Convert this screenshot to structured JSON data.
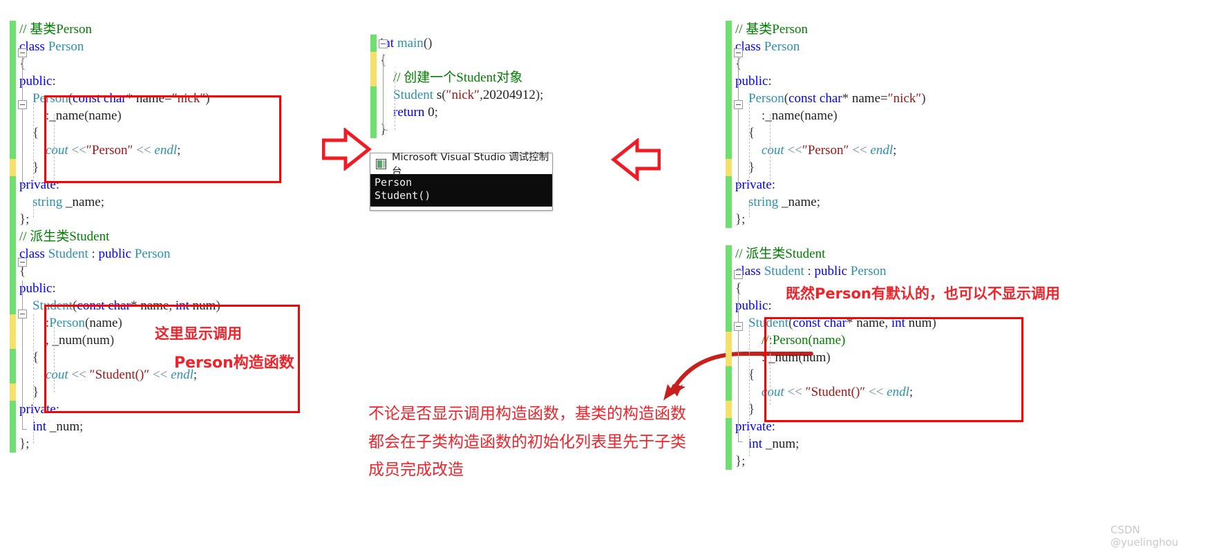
{
  "meta": {
    "watermark": "CSDN @yuelinghou",
    "accent_red": "#ff0000",
    "anno_red": "#f0232a",
    "comment_green": "#008000",
    "string_red": "#a31515",
    "keyword_blue": "#0000ff",
    "type_teal": "#2b91af",
    "gutter_green": "#6fe06f",
    "gutter_yellow": "#f5e06a"
  },
  "left_editor": {
    "name": "explicit-call-version",
    "lines": [
      "// 基类Person",
      "class Person",
      "{",
      "public:",
      "    Person(const char* name=\"nick\")",
      "        :_name(name)",
      "    {",
      "        cout <<\"Person\" << endl;",
      "    }",
      "private:",
      "    string _name;",
      "};",
      "// 派生类Student",
      "class Student : public Person",
      "{",
      "public:",
      "    Student(const char* name, int num)",
      "        :Person(name)",
      "        , _num(num)",
      "    {",
      "        cout << \"Student()\" << endl;",
      "    }",
      "private:",
      "    int _num;",
      "};"
    ],
    "gutter": [
      "g",
      "g",
      "g",
      "g",
      "g",
      "g",
      "g",
      "g",
      "y",
      "g",
      "g",
      "g",
      "g",
      "g",
      "g",
      "g",
      "g",
      "y",
      "y",
      "g",
      "g",
      "y",
      "g",
      "g",
      "g"
    ],
    "annotations": [
      {
        "name": "explicit-call-note-line1",
        "text": "这里显示调用"
      },
      {
        "name": "explicit-call-note-line2",
        "text": "Person构造函数"
      }
    ]
  },
  "middle": {
    "main_editor": {
      "name": "main-function",
      "lines": [
        "int main()",
        "{",
        "    // 创建一个Student对象",
        "    Student s(\"nick\",20204912);",
        "    return 0;",
        "}"
      ],
      "gutter": [
        "g",
        "y",
        "y",
        "g",
        "g",
        "g"
      ]
    },
    "console": {
      "title": "Microsoft Visual Studio 调试控制台",
      "output": [
        "Person",
        "Student()"
      ]
    },
    "arrows": [
      {
        "name": "arrow-left-to-main",
        "direction": "right"
      },
      {
        "name": "arrow-right-to-main",
        "direction": "left"
      }
    ],
    "note": {
      "name": "conclusion-note",
      "lines": [
        "不论是否显示调用构造函数，基类的构造函数",
        "都会在子类构造函数的初始化列表里先于子类",
        "成员完成改造"
      ]
    }
  },
  "right_editor": {
    "name": "implicit-call-version",
    "lines": [
      "// 基类Person",
      "class Person",
      "{",
      "public:",
      "    Person(const char* name=\"nick\")",
      "        :_name(name)",
      "    {",
      "        cout <<\"Person\" << endl;",
      "    }",
      "private:",
      "    string _name;",
      "};",
      "",
      "// 派生类Student",
      "class Student : public Person",
      "{",
      "public:",
      "    Student(const char* name, int num)",
      "        //:Person(name)",
      "        : _num(num)",
      "    {",
      "        cout << \"Student()\" << endl;",
      "    }",
      "private:",
      "    int _num;",
      "};"
    ],
    "gutter": [
      "g",
      "g",
      "g",
      "g",
      "g",
      "g",
      "g",
      "g",
      "y",
      "g",
      "g",
      "g",
      "n",
      "g",
      "g",
      "g",
      "g",
      "g",
      "y",
      "y",
      "g",
      "g",
      "y",
      "g",
      "g",
      "g"
    ],
    "annotation": {
      "name": "default-ctor-note",
      "text": "既然Person有默认的，也可以不显示调用"
    }
  }
}
